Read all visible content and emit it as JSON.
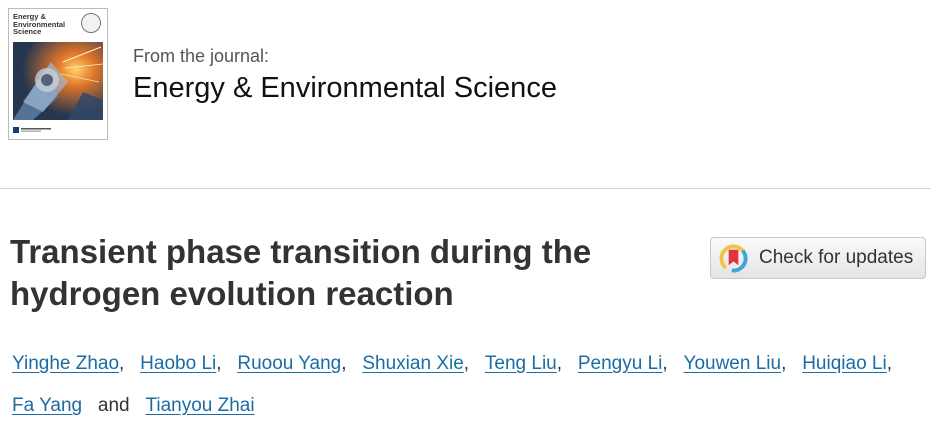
{
  "journal": {
    "from_label": "From the journal:",
    "name": "Energy & Environmental Science",
    "cover": {
      "title_lines": [
        "Energy &",
        "Environmental",
        "Science"
      ],
      "accent_color": "#1b3d6d"
    }
  },
  "article": {
    "title_line1": "Transient phase transition during the",
    "title_line2": "hydrogen evolution reaction"
  },
  "check_for_updates": {
    "label": "Check for updates",
    "icon": "crossmark-icon"
  },
  "authors": {
    "names": [
      "Yinghe Zhao",
      "Haobo Li",
      "Ruoou Yang",
      "Shuxian Xie",
      "Teng Liu",
      "Pengyu Li",
      "Youwen Liu",
      "Huiqiao Li",
      "Fa Yang",
      "Tianyou Zhai"
    ],
    "separator": ",",
    "conjunction": "and"
  },
  "colors": {
    "link": "#1a6ca3",
    "title": "#333333",
    "divider": "#d5d5d5"
  }
}
